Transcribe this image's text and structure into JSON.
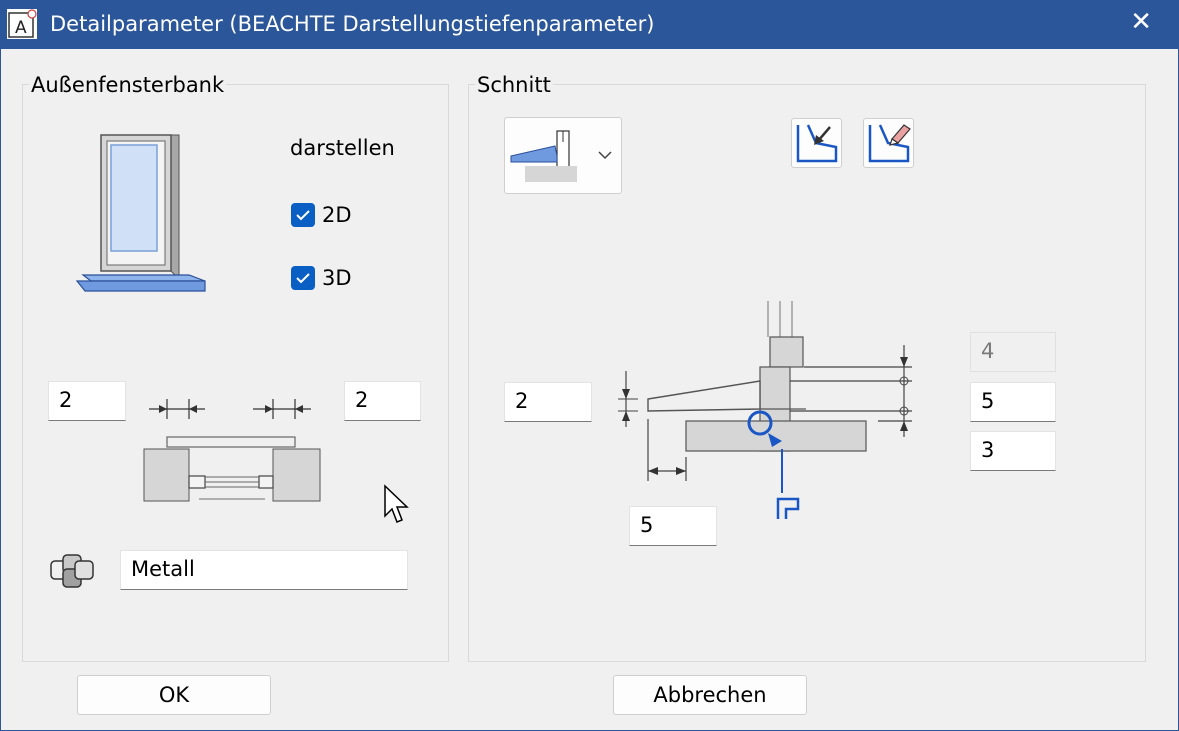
{
  "window": {
    "title": "Detailparameter (BEACHTE Darstellungstiefenparameter)",
    "close_glyph": "✕",
    "app_icon_letter": "A"
  },
  "left": {
    "group_label": "Außenfensterbank",
    "darstellen_label": "darstellen",
    "checkbox_2d": {
      "label": "2D",
      "checked": true
    },
    "checkbox_3d": {
      "label": "3D",
      "checked": true
    },
    "overhang_left": "2",
    "overhang_right": "2",
    "material": "Metall"
  },
  "right": {
    "group_label": "Schnitt",
    "thickness_left": "2",
    "dim_top_disabled": "4",
    "dim_mid": "5",
    "dim_bottom": "3",
    "dim_projection": "5"
  },
  "buttons": {
    "ok": "OK",
    "cancel": "Abbrechen"
  },
  "colors": {
    "accent": "#2b579a",
    "checkbox": "#0a5fc4",
    "sill_blue": "#6f9ae0",
    "pick_blue": "#1a56c4"
  }
}
